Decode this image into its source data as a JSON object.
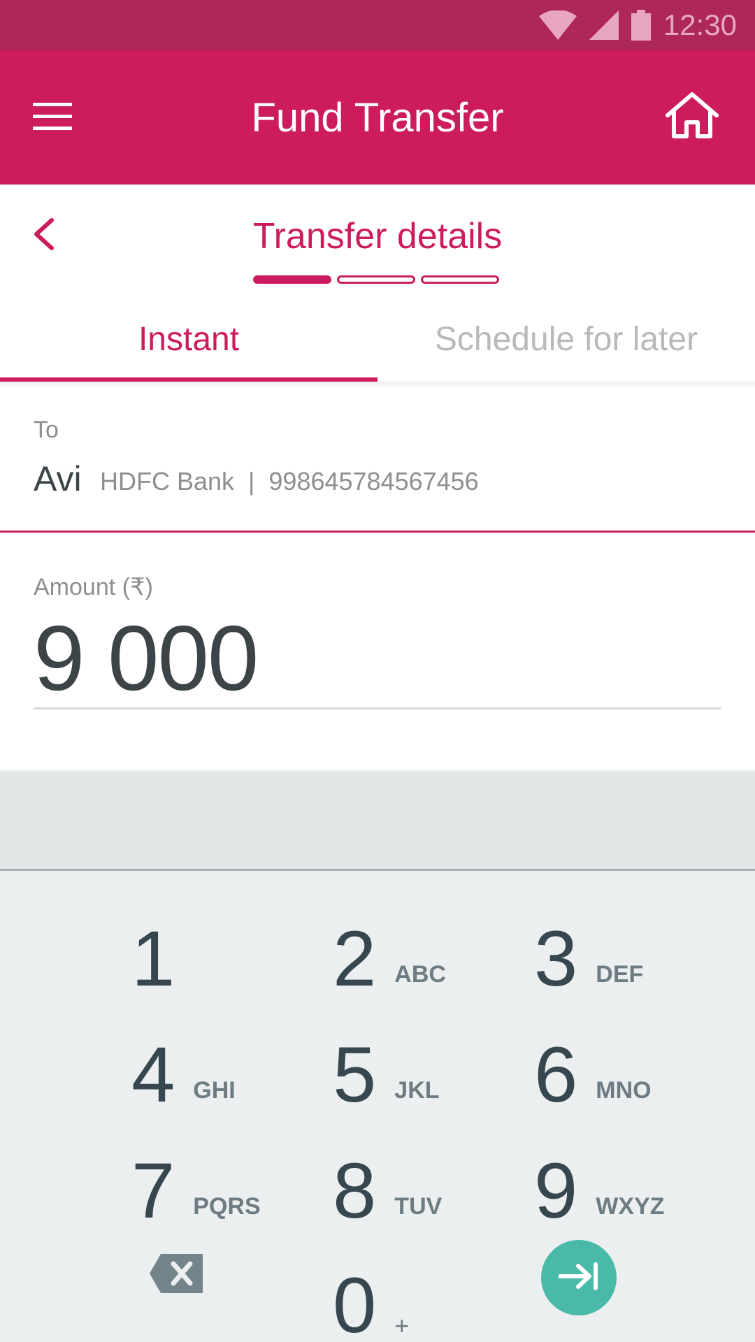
{
  "status_bar": {
    "time": "12:30",
    "icons": [
      "wifi-icon",
      "signal-icon",
      "battery-icon"
    ]
  },
  "app_bar": {
    "title": "Fund Transfer",
    "menu_icon": "menu-icon",
    "home_icon": "home-icon"
  },
  "sub_header": {
    "title": "Transfer details",
    "back_icon": "chevron-left-icon",
    "steps_total": 3,
    "current_step": 1
  },
  "tabs": [
    {
      "label": "Instant",
      "active": true
    },
    {
      "label": "Schedule for later",
      "active": false
    }
  ],
  "recipient": {
    "label": "To",
    "name": "Avi",
    "details": "HDFC Bank  |  998645784567456"
  },
  "amount": {
    "label": "Amount (₹)",
    "value": "9 000"
  },
  "keypad": {
    "keys": [
      {
        "digit": "1",
        "letters": ""
      },
      {
        "digit": "2",
        "letters": "ABC"
      },
      {
        "digit": "3",
        "letters": "DEF"
      },
      {
        "digit": "4",
        "letters": "GHI"
      },
      {
        "digit": "5",
        "letters": "JKL"
      },
      {
        "digit": "6",
        "letters": "MNO"
      },
      {
        "digit": "7",
        "letters": "PQRS"
      },
      {
        "digit": "8",
        "letters": "TUV"
      },
      {
        "digit": "9",
        "letters": "WXYZ"
      },
      {
        "digit": "0",
        "letters": "+"
      }
    ],
    "backspace_icon": "backspace-icon",
    "next_icon": "arrow-right-to-bar-icon"
  },
  "colors": {
    "status_bar": "#ad275b",
    "primary": "#cc1c5e",
    "keypad_bg": "#ebeff0",
    "accent_teal": "#49b9a8",
    "text_dark": "#3d4448",
    "text_muted": "#8e8e8e"
  }
}
